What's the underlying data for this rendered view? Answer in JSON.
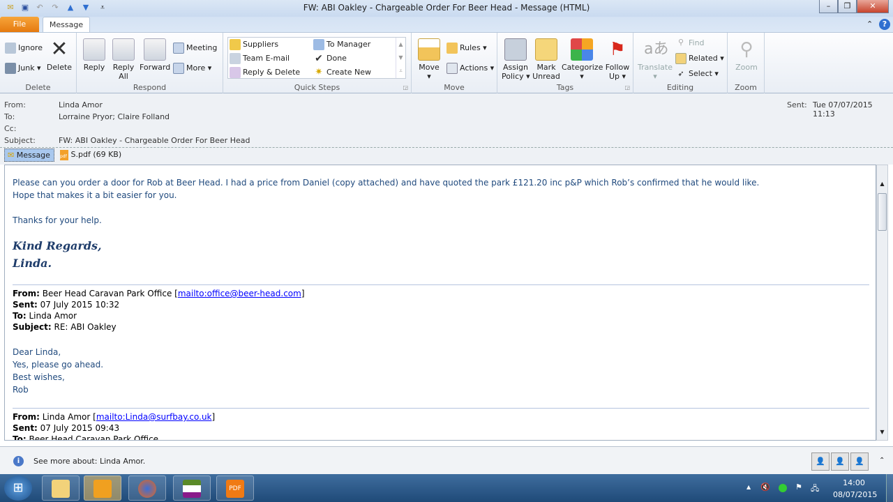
{
  "window": {
    "title": "FW: ABI Oakley - Chargeable Order For Beer Head  -  Message (HTML)"
  },
  "tabs": {
    "file": "File",
    "message": "Message"
  },
  "ribbon": {
    "delete": {
      "label": "Delete",
      "ignore": "Ignore",
      "junk": "Junk",
      "delete": "Delete"
    },
    "respond": {
      "label": "Respond",
      "reply": "Reply",
      "reply_all_1": "Reply",
      "reply_all_2": "All",
      "forward": "Forward",
      "meeting": "Meeting",
      "more": "More"
    },
    "quick_steps": {
      "label": "Quick Steps",
      "items": [
        "Suppliers",
        "Team E-mail",
        "Reply & Delete",
        "To Manager",
        "Done",
        "Create New"
      ]
    },
    "move": {
      "label": "Move",
      "move": "Move",
      "rules": "Rules",
      "actions": "Actions"
    },
    "tags": {
      "label": "Tags",
      "assign_1": "Assign",
      "assign_2": "Policy",
      "mark_1": "Mark",
      "mark_2": "Unread",
      "categorize": "Categorize",
      "follow_1": "Follow",
      "follow_2": "Up"
    },
    "editing": {
      "label": "Editing",
      "translate": "Translate",
      "find": "Find",
      "related": "Related",
      "select": "Select"
    },
    "zoom": {
      "label": "Zoom",
      "zoom": "Zoom"
    }
  },
  "header": {
    "from_label": "From:",
    "from": "Linda Amor",
    "to_label": "To:",
    "to": "Lorraine Pryor; Claire Folland",
    "cc_label": "Cc:",
    "subject_label": "Subject:",
    "subject": "FW: ABI Oakley - Chargeable Order For Beer Head",
    "sent_label": "Sent:",
    "sent": "Tue 07/07/2015 11:13"
  },
  "attachments": {
    "message": "Message",
    "pdf": "S.pdf (69 KB)"
  },
  "body": {
    "line1": "Please can you order a door for Rob at Beer Head.  I had a price from Daniel (copy attached) and have quoted the park £121.20 inc p&P which Rob’s confirmed that he would like.",
    "line2": "Hope that makes it a bit easier for you.",
    "thanks": "Thanks for your help.",
    "sig1": "Kind Regards,",
    "sig2": "Linda.",
    "q1": {
      "from_l": "From:",
      "from": " Beer Head Caravan Park Office [",
      "from_link": "mailto:office@beer-head.com",
      "from_end": "]",
      "sent_l": "Sent:",
      "sent": " 07 July 2015 10:32",
      "to_l": "To:",
      "to": " Linda Amor",
      "subj_l": "Subject:",
      "subj": " RE: ABI Oakley",
      "lines": [
        "Dear Linda,",
        "Yes, please go ahead.",
        "Best wishes,",
        "Rob"
      ]
    },
    "q2": {
      "from_l": "From:",
      "from": " Linda Amor [",
      "from_link": "mailto:Linda@surfbay.co.uk",
      "from_end": "]",
      "sent_l": "Sent:",
      "sent": " 07 July 2015 09:43",
      "to_l": "To:",
      "to": " Beer Head Caravan Park Office"
    }
  },
  "people_pane": {
    "text": "See more about: Linda Amor."
  },
  "taskbar": {
    "time": "14:00",
    "date": "08/07/2015",
    "apps": [
      "Windows Explorer",
      "Outlook",
      "Firefox",
      "Sage",
      "PDF"
    ]
  }
}
